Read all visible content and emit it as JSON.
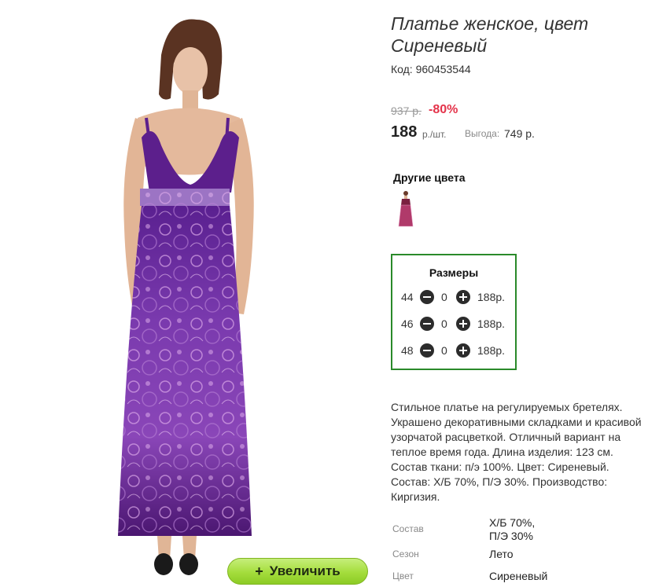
{
  "product": {
    "title": "Платье женское, цвет Сиреневый",
    "code_label": "Код:",
    "code": "960453544",
    "old_price": "937 р.",
    "discount": "-80%",
    "price": "188",
    "unit": "р./шт.",
    "benefit_label": "Выгода:",
    "benefit_value": "749 р."
  },
  "other_colors": {
    "label": "Другие цвета",
    "thumbnail_icon": "dress-thumbnail"
  },
  "zoom_button": {
    "icon": "+",
    "label": "Увеличить"
  },
  "sizes": {
    "title": "Размеры",
    "rows": [
      {
        "size": "44",
        "qty": "0",
        "price": "188р."
      },
      {
        "size": "46",
        "qty": "0",
        "price": "188р."
      },
      {
        "size": "48",
        "qty": "0",
        "price": "188р."
      }
    ],
    "minus_icon": "minus-circle-icon",
    "plus_icon": "plus-circle-icon",
    "border_color": "#2a8a2a"
  },
  "description": "Стильное платье на регулируемых бретелях. Украшено декоративными складками и красивой узорчатой расцветкой. Отличный вариант на теплое время года. Длина изделия: 123 см. Состав ткани: п/э 100%. Цвет: Сиреневый. Состав: Х/Б 70%, П/Э 30%. Производство: Киргизия.",
  "specs": [
    {
      "key": "Состав",
      "value_line1": "Х/Б 70%,",
      "value_line2": "П/Э 30%"
    },
    {
      "key": "Сезон",
      "value_line1": "Лето",
      "value_line2": ""
    },
    {
      "key": "Цвет",
      "value_line1": "Сиреневый",
      "value_line2": ""
    }
  ],
  "colors": {
    "accent_green": "#a4dd3c",
    "discount_red": "#e4334a",
    "dress_purple": "#6a2a9a"
  }
}
